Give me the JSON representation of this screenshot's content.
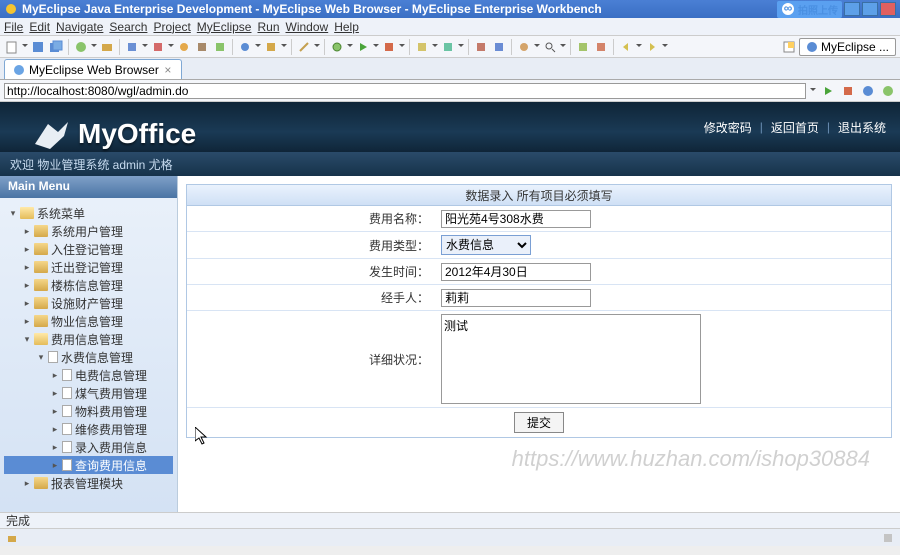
{
  "window": {
    "title": "MyEclipse Java Enterprise Development - MyEclipse Web Browser - MyEclipse Enterprise Workbench",
    "upload_label": "拍照上传"
  },
  "menubar": [
    "File",
    "Edit",
    "Navigate",
    "Search",
    "Project",
    "MyEclipse",
    "Run",
    "Window",
    "Help"
  ],
  "perspective_label": "MyEclipse ...",
  "browser_tab": {
    "title": "MyEclipse Web Browser"
  },
  "url": "http://localhost:8080/wgl/admin.do",
  "app": {
    "logo_text": "MyOffice",
    "toplinks": [
      "修改密码",
      "返回首页",
      "退出系统"
    ],
    "welcome": "欢迎 物业管理系统 admin 尤格",
    "menu_header": "Main Menu",
    "tree": {
      "root": "系统菜单",
      "items": [
        "系统用户管理",
        "入住登记管理",
        "迁出登记管理",
        "楼栋信息管理",
        "设施财产管理",
        "物业信息管理"
      ],
      "fee_mgmt": "费用信息管理",
      "fee_children": [
        "水费信息管理",
        "电费信息管理",
        "煤气费用管理",
        "物料费用管理",
        "维修费用管理",
        "录入费用信息",
        "查询费用信息"
      ],
      "report": "报表管理模块"
    },
    "form": {
      "title": "数据录入 所有项目必须填写",
      "name_label": "费用名称：",
      "name_value": "阳光苑4号308水费",
      "type_label": "费用类型：",
      "type_value": "水费信息",
      "date_label": "发生时间：",
      "date_value": "2012年4月30日",
      "handler_label": "经手人：",
      "handler_value": "莉莉",
      "detail_label": "详细状况：",
      "detail_value": "测试",
      "submit": "提交"
    }
  },
  "statusbar": "完成",
  "watermark": "https://www.huzhan.com/ishop30884"
}
